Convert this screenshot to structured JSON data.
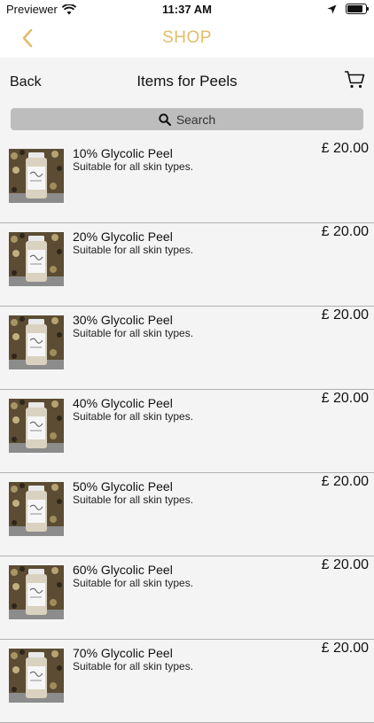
{
  "status_bar": {
    "carrier": "Previewer",
    "time": "11:37 AM"
  },
  "nav": {
    "title": "SHOP",
    "accent_color": "#e2bd6a"
  },
  "header": {
    "back_label": "Back",
    "title": "Items for Peels"
  },
  "search": {
    "label": "Search"
  },
  "products": [
    {
      "name": "10% Glycolic Peel",
      "description": "Suitable for all skin types.",
      "price": "£ 20.00"
    },
    {
      "name": "20% Glycolic Peel",
      "description": "Suitable for all skin types.",
      "price": "£ 20.00"
    },
    {
      "name": "30% Glycolic Peel",
      "description": "Suitable for all skin types.",
      "price": "£ 20.00"
    },
    {
      "name": "40% Glycolic Peel",
      "description": "Suitable for all skin types.",
      "price": "£ 20.00"
    },
    {
      "name": "50% Glycolic Peel",
      "description": "Suitable for all skin types.",
      "price": "£ 20.00"
    },
    {
      "name": "60% Glycolic Peel",
      "description": "Suitable for all skin types.",
      "price": "£ 20.00"
    },
    {
      "name": "70% Glycolic Peel",
      "description": "Suitable for all skin types.",
      "price": "£ 20.00"
    }
  ]
}
